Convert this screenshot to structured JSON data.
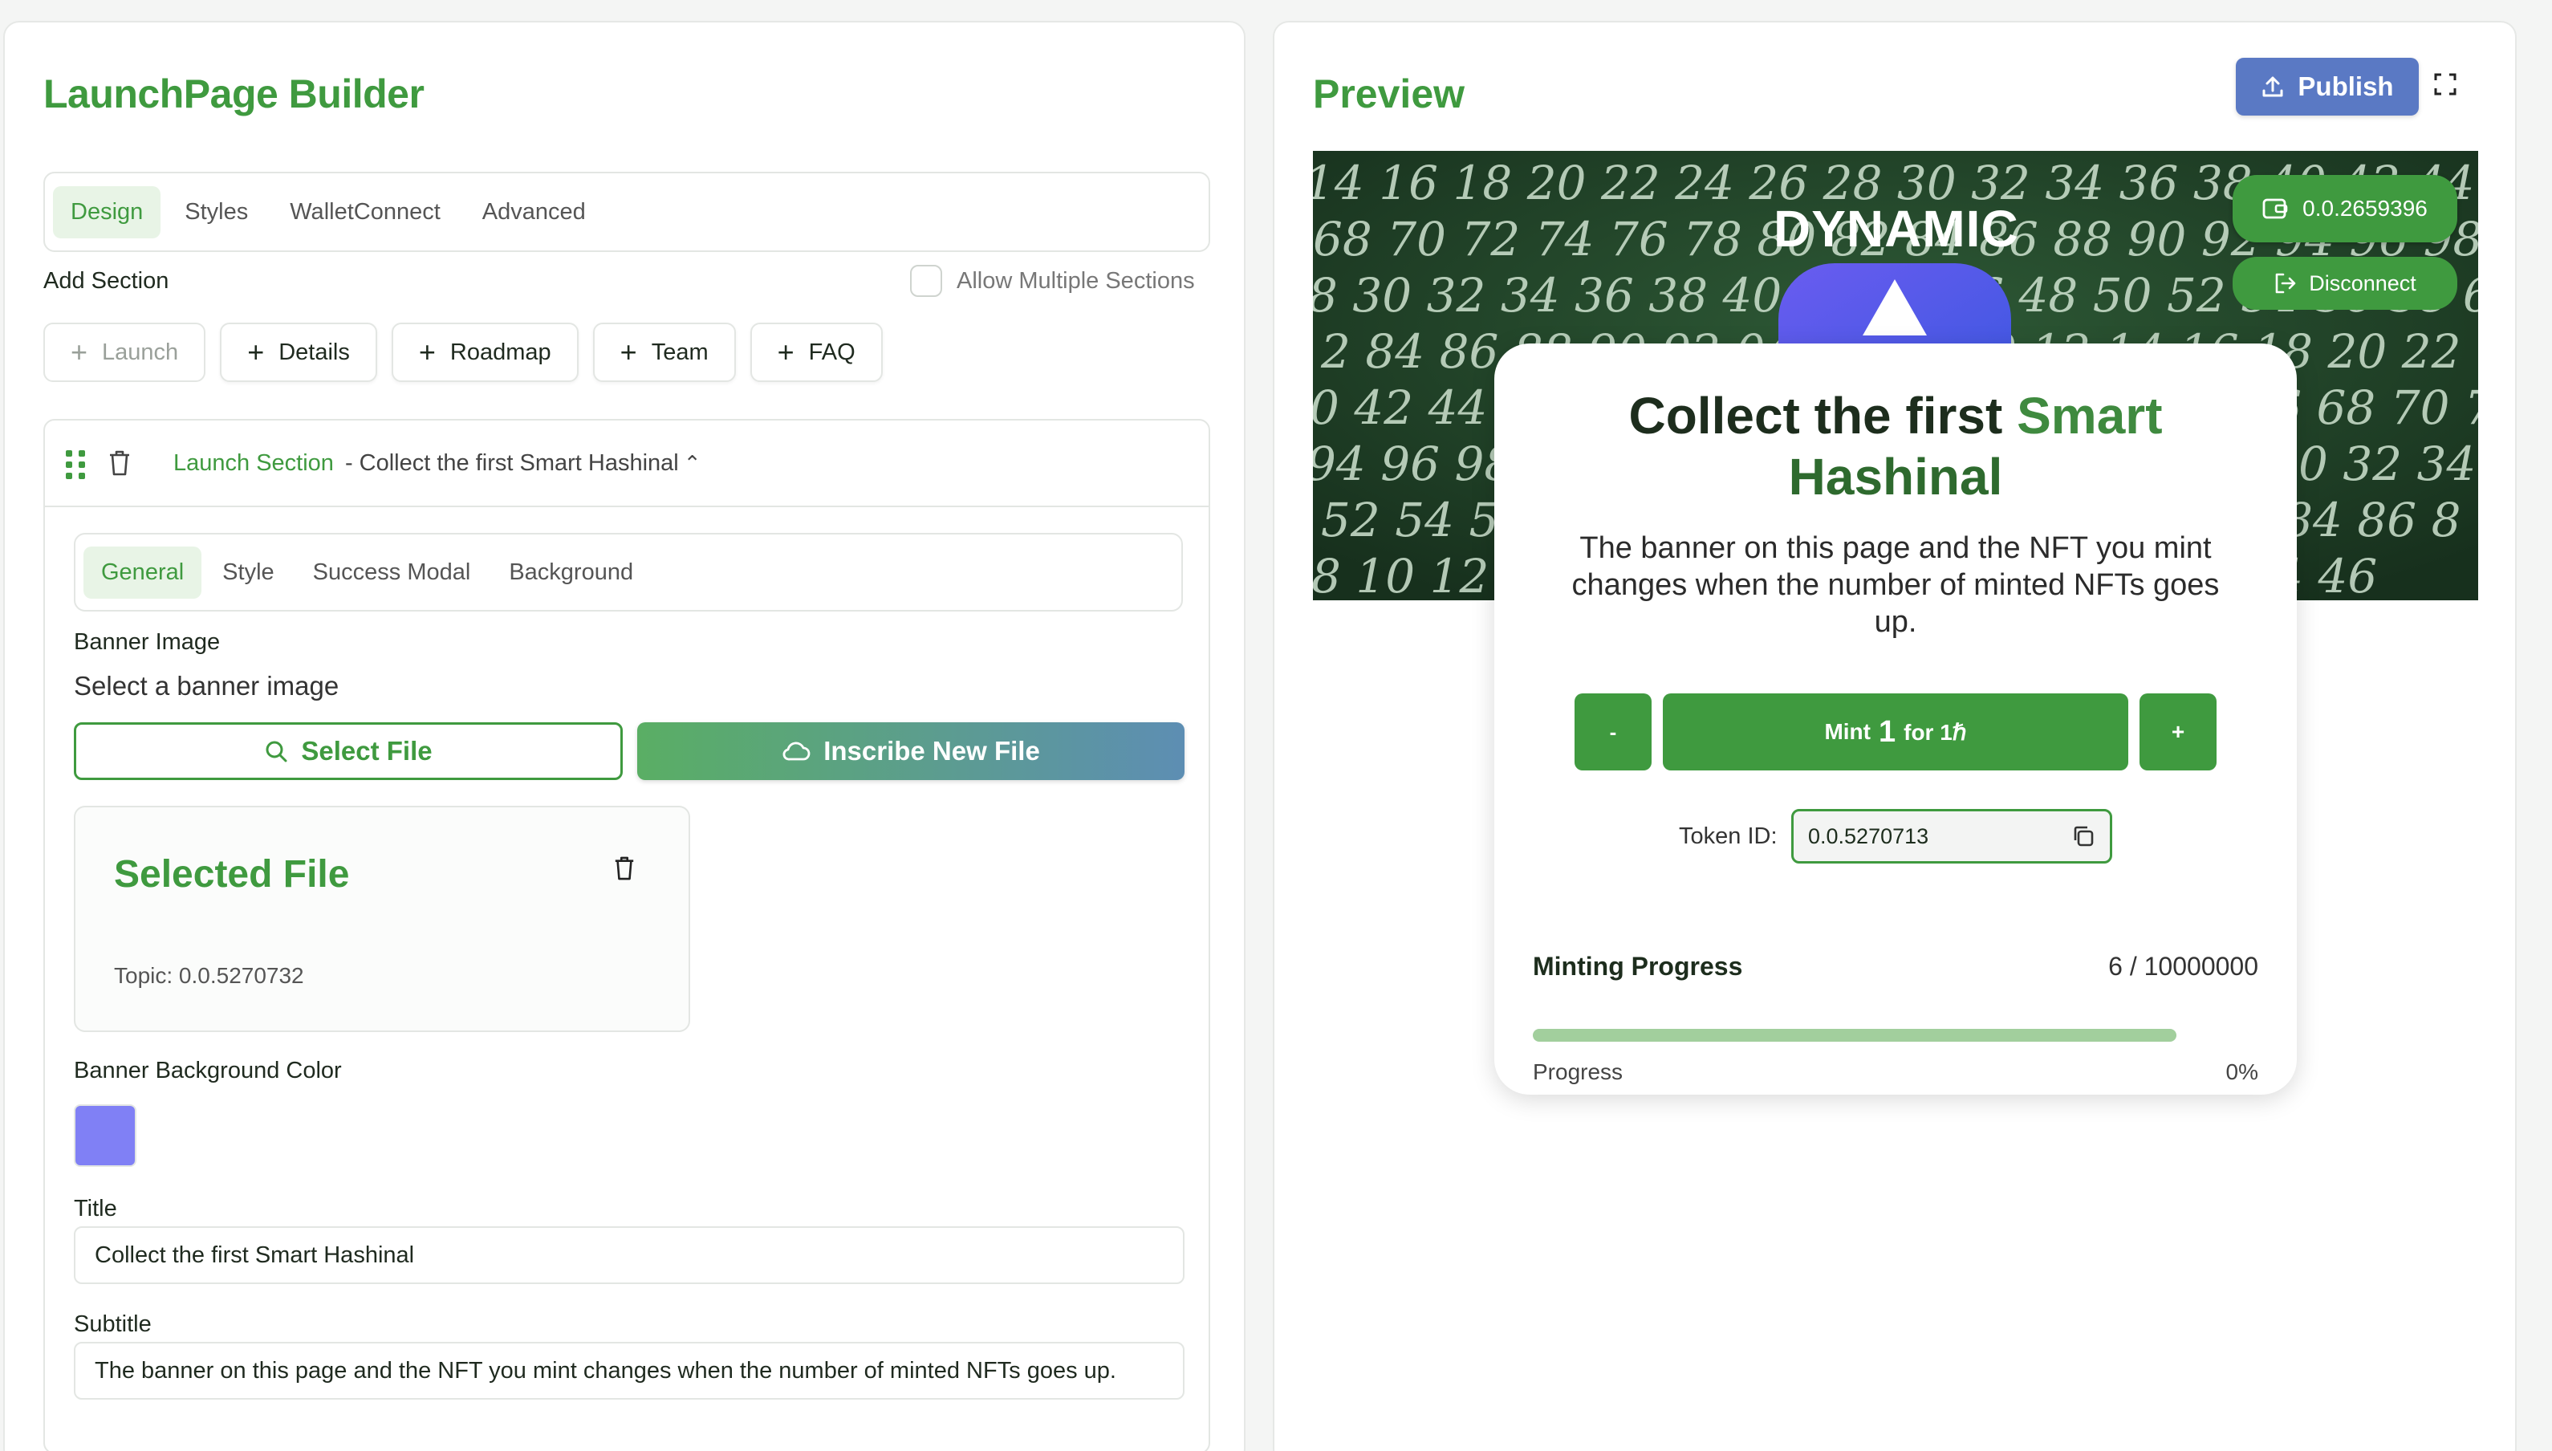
{
  "builder": {
    "title": "LaunchPage Builder",
    "tabs": [
      "Design",
      "Styles",
      "WalletConnect",
      "Advanced"
    ],
    "active_tab": "Design",
    "add_section_label": "Add Section",
    "allow_multiple_label": "Allow Multiple Sections",
    "allow_multiple_checked": false,
    "add_buttons": [
      {
        "label": "Launch",
        "disabled": true
      },
      {
        "label": "Details",
        "disabled": false
      },
      {
        "label": "Roadmap",
        "disabled": false
      },
      {
        "label": "Team",
        "disabled": false
      },
      {
        "label": "FAQ",
        "disabled": false
      }
    ],
    "section": {
      "name": "Launch Section",
      "subtitle": "- Collect the first Smart Hashinal",
      "tabs": [
        "General",
        "Style",
        "Success Modal",
        "Background"
      ],
      "active_tab": "General",
      "banner_image_label": "Banner Image",
      "banner_hint": "Select a banner image",
      "select_file_label": "Select File",
      "inscribe_label": "Inscribe New File",
      "selected_file_title": "Selected File",
      "selected_file_topic": "Topic: 0.0.5270732",
      "banner_bg_label": "Banner Background Color",
      "banner_bg_color": "#8080f5",
      "title_label": "Title",
      "title_value": "Collect the first Smart Hashinal",
      "subtitle_label": "Subtitle",
      "subtitle_value": "The banner on this page and the NFT you mint changes when the number of minted NFTs goes up."
    }
  },
  "preview": {
    "title": "Preview",
    "publish_label": "Publish",
    "banner_word": "DYNAMIC",
    "wallet_account": "0.0.2659396",
    "disconnect_label": "Disconnect",
    "mint_title_part1": "Collect the first",
    "mint_title_part2": "Smart",
    "mint_title_part3": "Hashinal",
    "mint_subtitle": "The banner on this page and the NFT you mint changes when the number of minted NFTs goes up.",
    "minus_label": "-",
    "plus_label": "+",
    "mint_prefix": "Mint",
    "mint_qty": "1",
    "mint_suffix": "for 1ℏ",
    "token_label": "Token ID:",
    "token_value": "0.0.5270713",
    "progress_label": "Minting Progress",
    "progress_count": "6 / 10000000",
    "progress_sub_label": "Progress",
    "progress_percent": "0%",
    "progress_fraction": 6e-07
  },
  "colors": {
    "accent_green": "#3f9a3f",
    "publish_blue": "#5a79c4",
    "banner_swatch": "#8080f5"
  },
  "icons": [
    "drag-handle-icon",
    "trash-icon",
    "chevron-up-icon",
    "plus-icon",
    "search-icon",
    "cloud-icon",
    "upload-icon",
    "expand-icon",
    "wallet-icon",
    "logout-icon",
    "copy-icon"
  ]
}
